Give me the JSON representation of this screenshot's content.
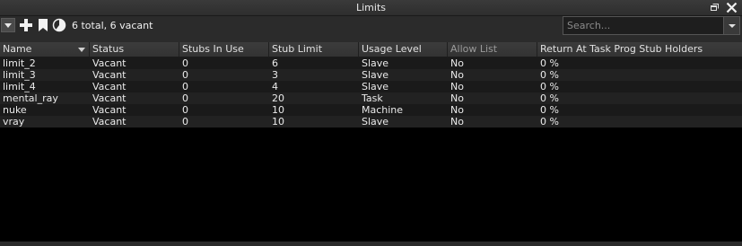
{
  "window": {
    "title": "Limits"
  },
  "toolbar": {
    "summary": "6 total, 6 vacant",
    "search_placeholder": "Search..."
  },
  "columns": [
    {
      "label": "Name"
    },
    {
      "label": "Status"
    },
    {
      "label": "Stubs In Use"
    },
    {
      "label": "Stub Limit"
    },
    {
      "label": "Usage Level"
    },
    {
      "label": "Allow List"
    },
    {
      "label": "Return At Task Prog Stub Holders"
    }
  ],
  "rows": [
    {
      "name": "limit_2",
      "status": "Vacant",
      "stubs_in_use": "0",
      "stub_limit": "6",
      "usage_level": "Slave",
      "allow_list": "No",
      "return_at": "0 %"
    },
    {
      "name": "limit_3",
      "status": "Vacant",
      "stubs_in_use": "0",
      "stub_limit": "3",
      "usage_level": "Slave",
      "allow_list": "No",
      "return_at": "0 %"
    },
    {
      "name": "limit_4",
      "status": "Vacant",
      "stubs_in_use": "0",
      "stub_limit": "4",
      "usage_level": "Slave",
      "allow_list": "No",
      "return_at": "0 %"
    },
    {
      "name": "mental_ray",
      "status": "Vacant",
      "stubs_in_use": "0",
      "stub_limit": "20",
      "usage_level": "Task",
      "allow_list": "No",
      "return_at": "0 %"
    },
    {
      "name": "nuke",
      "status": "Vacant",
      "stubs_in_use": "0",
      "stub_limit": "10",
      "usage_level": "Machine",
      "allow_list": "No",
      "return_at": "0 %"
    },
    {
      "name": "vray",
      "status": "Vacant",
      "stubs_in_use": "0",
      "stub_limit": "10",
      "usage_level": "Slave",
      "allow_list": "No",
      "return_at": "0 %"
    }
  ],
  "icons": {
    "menu": "chevron-down-icon",
    "add": "plus-icon",
    "bookmark": "bookmark-icon",
    "pie": "pie-chart-icon",
    "restore": "window-restore-icon",
    "close": "close-icon"
  },
  "colors": {
    "panel_bg": "#2b2b2b",
    "table_bg": "#000000",
    "row_odd": "#1a1a1a",
    "row_even": "#222222",
    "text": "#eaeaea"
  }
}
